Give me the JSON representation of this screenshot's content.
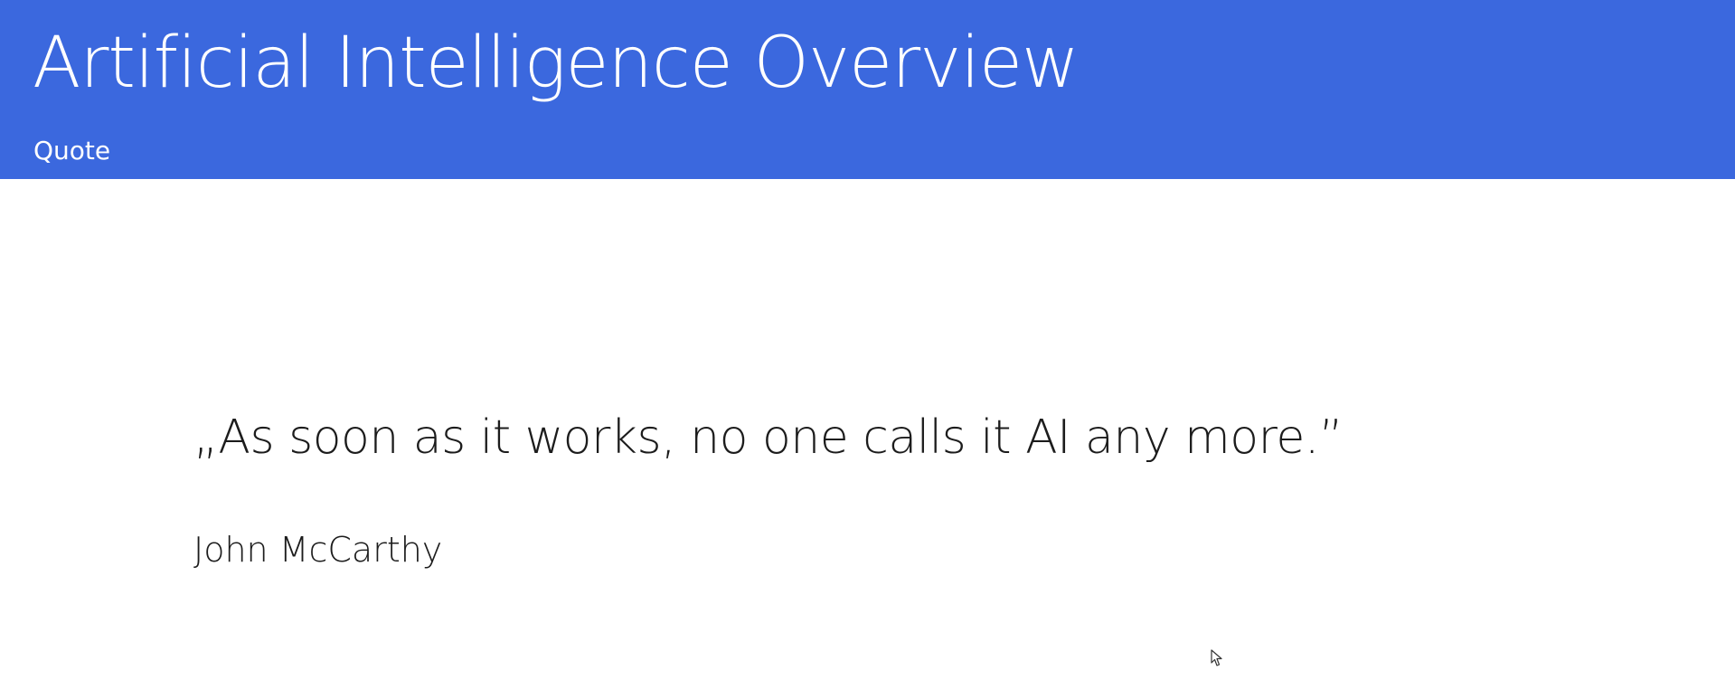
{
  "header": {
    "title": "Artificial Intelligence Overview",
    "subtitle": "Quote",
    "background_color": "#3b68de"
  },
  "quote": {
    "text": "„As soon as it works, no one calls it AI any more.”",
    "author": "John McCarthy"
  },
  "cursor": {
    "icon": "mouse-pointer-icon"
  }
}
